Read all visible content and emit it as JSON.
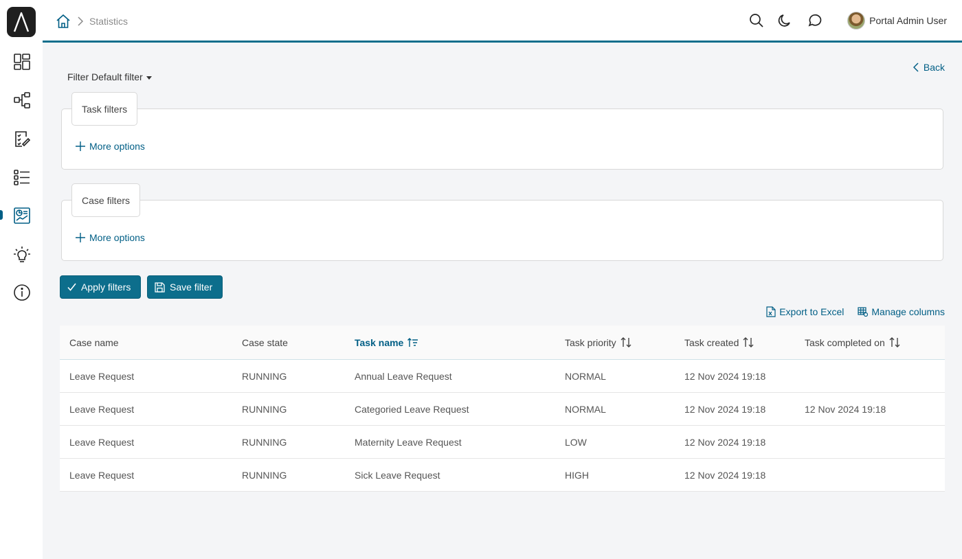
{
  "breadcrumb": {
    "current": "Statistics"
  },
  "user": {
    "name": "Portal Admin User"
  },
  "colors": {
    "accent": "#0d6e8c",
    "link": "#005e85"
  },
  "sidebar": {
    "items": [
      {
        "icon": "dashboard-icon",
        "active": false
      },
      {
        "icon": "process-icon",
        "active": false
      },
      {
        "icon": "task-list-icon",
        "active": false
      },
      {
        "icon": "case-list-icon",
        "active": false
      },
      {
        "icon": "statistics-icon",
        "active": true
      },
      {
        "icon": "idea-icon",
        "active": false
      },
      {
        "icon": "info-icon",
        "active": false
      }
    ]
  },
  "filter": {
    "toggle_label": "Filter Default filter",
    "back_label": "Back",
    "task_filters_label": "Task filters",
    "case_filters_label": "Case filters",
    "more_options_label": "More options",
    "apply_label": "Apply filters",
    "save_label": "Save filter"
  },
  "table": {
    "export_label": "Export to Excel",
    "manage_columns_label": "Manage columns",
    "columns": [
      "Case name",
      "Case state",
      "Task name",
      "Task priority",
      "Task created",
      "Task completed on"
    ],
    "rows": [
      [
        "Leave Request",
        "RUNNING",
        "Annual Leave Request",
        "NORMAL",
        "12 Nov 2024 19:18",
        ""
      ],
      [
        "Leave Request",
        "RUNNING",
        "Categoried Leave Request",
        "NORMAL",
        "12 Nov 2024 19:18",
        "12 Nov 2024 19:18"
      ],
      [
        "Leave Request",
        "RUNNING",
        "Maternity Leave Request",
        "LOW",
        "12 Nov 2024 19:18",
        ""
      ],
      [
        "Leave Request",
        "RUNNING",
        "Sick Leave Request",
        "HIGH",
        "12 Nov 2024 19:18",
        ""
      ]
    ]
  }
}
